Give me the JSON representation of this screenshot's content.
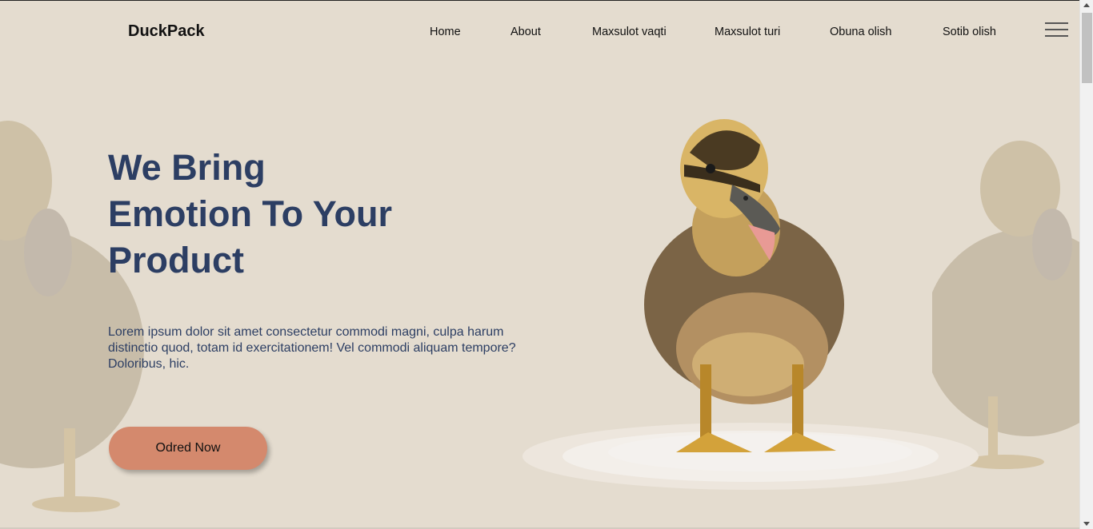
{
  "header": {
    "logo": "DuckPack",
    "nav": [
      "Home",
      "About",
      "Maxsulot vaqti",
      "Maxsulot turi",
      "Obuna olish",
      "Sotib olish"
    ],
    "menu_icon": "hamburger-menu-icon"
  },
  "hero": {
    "headline_lines": [
      "We Bring",
      "Emotion To Your",
      "Product"
    ],
    "description": "Lorem ipsum dolor sit amet consectetur commodi magni, culpa harum distinctio quod, totam id exercitationem! Vel commodi aliquam tempore? Doloribus, hic.",
    "cta_label": "Odred Now"
  },
  "colors": {
    "background": "#e4dccf",
    "heading": "#2c3e63",
    "cta": "#d4896d"
  }
}
